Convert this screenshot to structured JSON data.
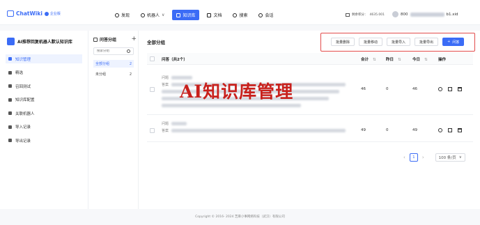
{
  "app": {
    "name": "ChatWiki",
    "badge": "企业版"
  },
  "nav": [
    {
      "label": "发现",
      "icon": "compass-icon"
    },
    {
      "label": "机器人",
      "icon": "robot-icon"
    },
    {
      "label": "知识库",
      "icon": "book-icon",
      "active": true
    },
    {
      "label": "文档",
      "icon": "doc-icon"
    },
    {
      "label": "搜索",
      "icon": "search-icon"
    },
    {
      "label": "会话",
      "icon": "chat-icon"
    }
  ],
  "header": {
    "balance_label": "剩余积分：",
    "balance_value": "4635.001",
    "user_suffix": "...id",
    "user_prefix": "800",
    "user_blur": "12345678901234",
    "user_mid": "b1.xid"
  },
  "kb": {
    "title": "AI推荐回复机器人默认知识库",
    "menu": [
      {
        "label": "知识管理",
        "active": true
      },
      {
        "label": "精选"
      },
      {
        "label": "召回测试"
      },
      {
        "label": "知识库配置"
      },
      {
        "label": "关联机器人"
      },
      {
        "label": "导入记录"
      },
      {
        "label": "导出记录"
      }
    ]
  },
  "groups": {
    "title": "问答分组",
    "search_placeholder": "搜索分组",
    "items": [
      {
        "label": "全部分组",
        "count": "2",
        "active": true
      },
      {
        "label": "未分组",
        "count": "2"
      }
    ]
  },
  "main": {
    "title": "全部分组",
    "actions": [
      "批量删除",
      "批量移动",
      "批量导入",
      "批量导出"
    ],
    "primary_action": "问答",
    "columns": {
      "question": "问答（共2个）",
      "total": "合计",
      "yesterday": "昨日",
      "today": "今日",
      "ops": "操作"
    },
    "rows": [
      {
        "q_tag": "问题",
        "a_tag": "答案",
        "total": "46",
        "yesterday": "0",
        "today": "46"
      },
      {
        "q_tag": "问题",
        "a_tag": "答案",
        "total": "49",
        "yesterday": "0",
        "today": "49"
      }
    ],
    "overlay": "AI知识库管理"
  },
  "pager": {
    "current": "1",
    "size": "100 条/页"
  },
  "footer": "Copyright © 2016- 2024 芝麻小事网络科技（武汉）有限公司"
}
